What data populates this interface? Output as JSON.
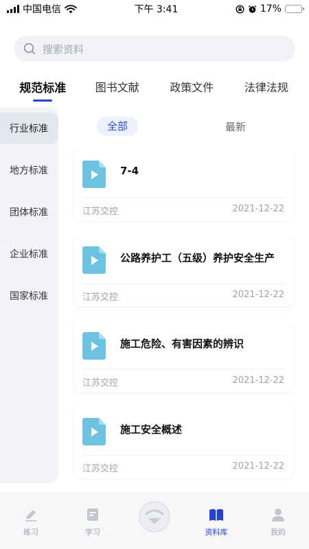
{
  "status_bar": {
    "carrier": "中国电信",
    "time": "下午 3:41",
    "battery": "17%",
    "battery_level": 0.17
  },
  "search": {
    "placeholder": "搜索资料"
  },
  "tabs": [
    {
      "label": "规范标准",
      "active": true
    },
    {
      "label": "图书文献",
      "active": false
    },
    {
      "label": "政策文件",
      "active": false
    },
    {
      "label": "法律法规",
      "active": false
    }
  ],
  "sidebar": {
    "items": [
      {
        "label": "行业标准",
        "active": true
      },
      {
        "label": "地方标准",
        "active": false
      },
      {
        "label": "团体标准",
        "active": false
      },
      {
        "label": "企业标准",
        "active": false
      },
      {
        "label": "国家标准",
        "active": false
      }
    ]
  },
  "filter": {
    "all": "全部",
    "latest": "最新"
  },
  "list": [
    {
      "title": "7-4",
      "source": "江苏交控",
      "date": "2021-12-22"
    },
    {
      "title": "公路养护工（五级）养护安全生产",
      "source": "江苏交控",
      "date": "2021-12-22"
    },
    {
      "title": "施工危险、有害因素的辨识",
      "source": "江苏交控",
      "date": "2021-12-22"
    },
    {
      "title": "施工安全概述",
      "source": "江苏交控",
      "date": "2021-12-22"
    }
  ],
  "bottom_nav": [
    {
      "label": "练习",
      "icon": "pencil-icon",
      "active": false
    },
    {
      "label": "学习",
      "icon": "document-icon",
      "active": false
    },
    {
      "label": "资料库",
      "icon": "book-icon",
      "active": true
    },
    {
      "label": "我的",
      "icon": "person-icon",
      "active": false
    }
  ],
  "colors": {
    "accent": "#2742c8",
    "doc_icon": "#6ec3e3",
    "muted_text": "#9da2ab"
  }
}
